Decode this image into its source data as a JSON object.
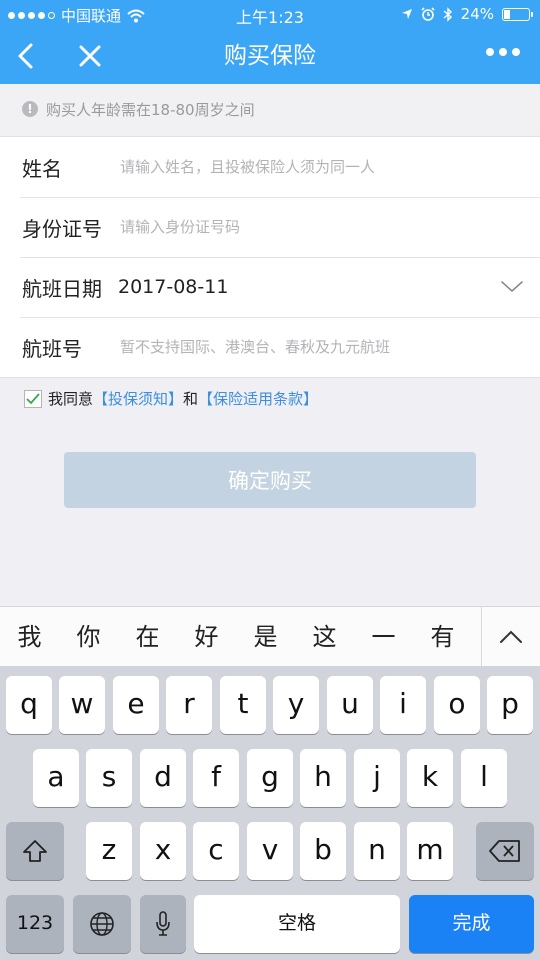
{
  "status_bar": {
    "carrier": "中国联通",
    "time": "上午1:23",
    "battery": "24%",
    "battery_level": 0.24
  },
  "nav": {
    "title": "购买保险",
    "back_icon": "chevron-left-icon",
    "close_icon": "close-icon",
    "more_icon": "more-dots-icon"
  },
  "notice": {
    "icon": "info-icon",
    "text": "购买人年龄需在18-80周岁之间"
  },
  "form": {
    "name": {
      "label": "姓名",
      "placeholder": "请输入姓名，且投被保险人须为同一人"
    },
    "id": {
      "label": "身份证号",
      "placeholder": "请输入身份证号码"
    },
    "date": {
      "label": "航班日期",
      "value": "2017-08-11"
    },
    "flight": {
      "label": "航班号",
      "placeholder": "暂不支持国际、港澳台、春秋及九元航班"
    }
  },
  "agree": {
    "checked": true,
    "prefix": "我同意",
    "link1": "【投保须知】",
    "middle": "和",
    "link2": "【保险适用条款】"
  },
  "confirm_button": "确定购买",
  "keyboard": {
    "candidates": [
      "我",
      "你",
      "在",
      "好",
      "是",
      "这",
      "一",
      "有"
    ],
    "row1": [
      "q",
      "w",
      "e",
      "r",
      "t",
      "y",
      "u",
      "i",
      "o",
      "p"
    ],
    "row2": [
      "a",
      "s",
      "d",
      "f",
      "g",
      "h",
      "j",
      "k",
      "l"
    ],
    "row3": [
      "z",
      "x",
      "c",
      "v",
      "b",
      "n",
      "m"
    ],
    "numbers_key": "123",
    "space_key": "空格",
    "done_key": "完成"
  },
  "colors": {
    "header": "#3aa6f5",
    "link": "#3b8fe0",
    "button_disabled": "#c3d3e1",
    "done_key": "#1a82f5"
  }
}
